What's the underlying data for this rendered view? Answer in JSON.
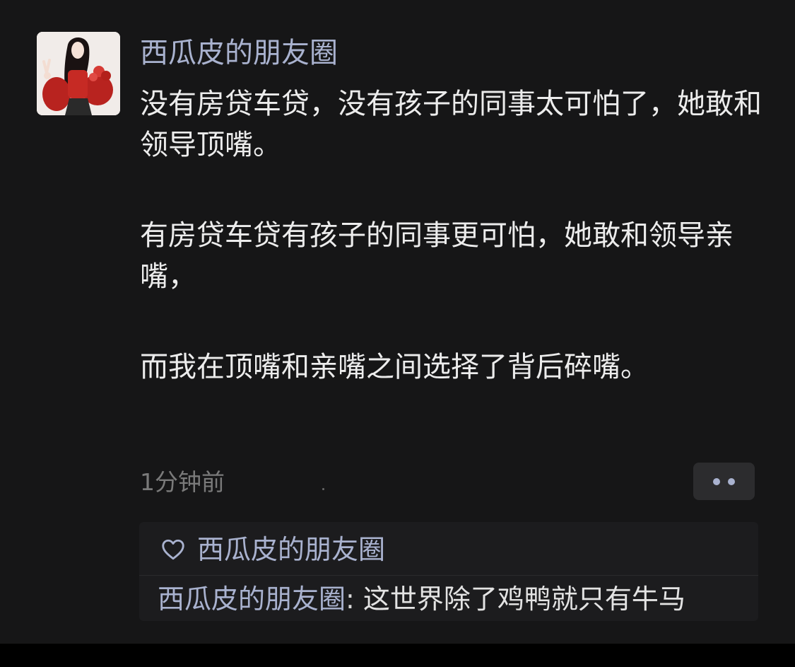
{
  "post": {
    "author": "西瓜皮的朋友圈",
    "avatar_icon": "portrait-avatar",
    "paragraphs": [
      "没有房贷车贷，没有孩子的同事太可怕了，她敢和领导顶嘴。",
      "有房贷车贷有孩子的同事更可怕，她敢和领导亲嘴，",
      "而我在顶嘴和亲嘴之间选择了背后碎嘴。"
    ],
    "time": "1分钟前",
    "more_icon": "more-dots-icon"
  },
  "interactions": {
    "like_icon": "heart-outline-icon",
    "likes": [
      "西瓜皮的朋友圈"
    ],
    "comments": [
      {
        "author": "西瓜皮的朋友圈",
        "separator": ": ",
        "text": "这世界除了鸡鸭就只有牛马"
      }
    ]
  },
  "colors": {
    "background": "#161617",
    "name_blue": "#a9b2cf",
    "text": "#ececec",
    "time_gray": "#7a7a7a",
    "panel": "#1c1c1e"
  }
}
